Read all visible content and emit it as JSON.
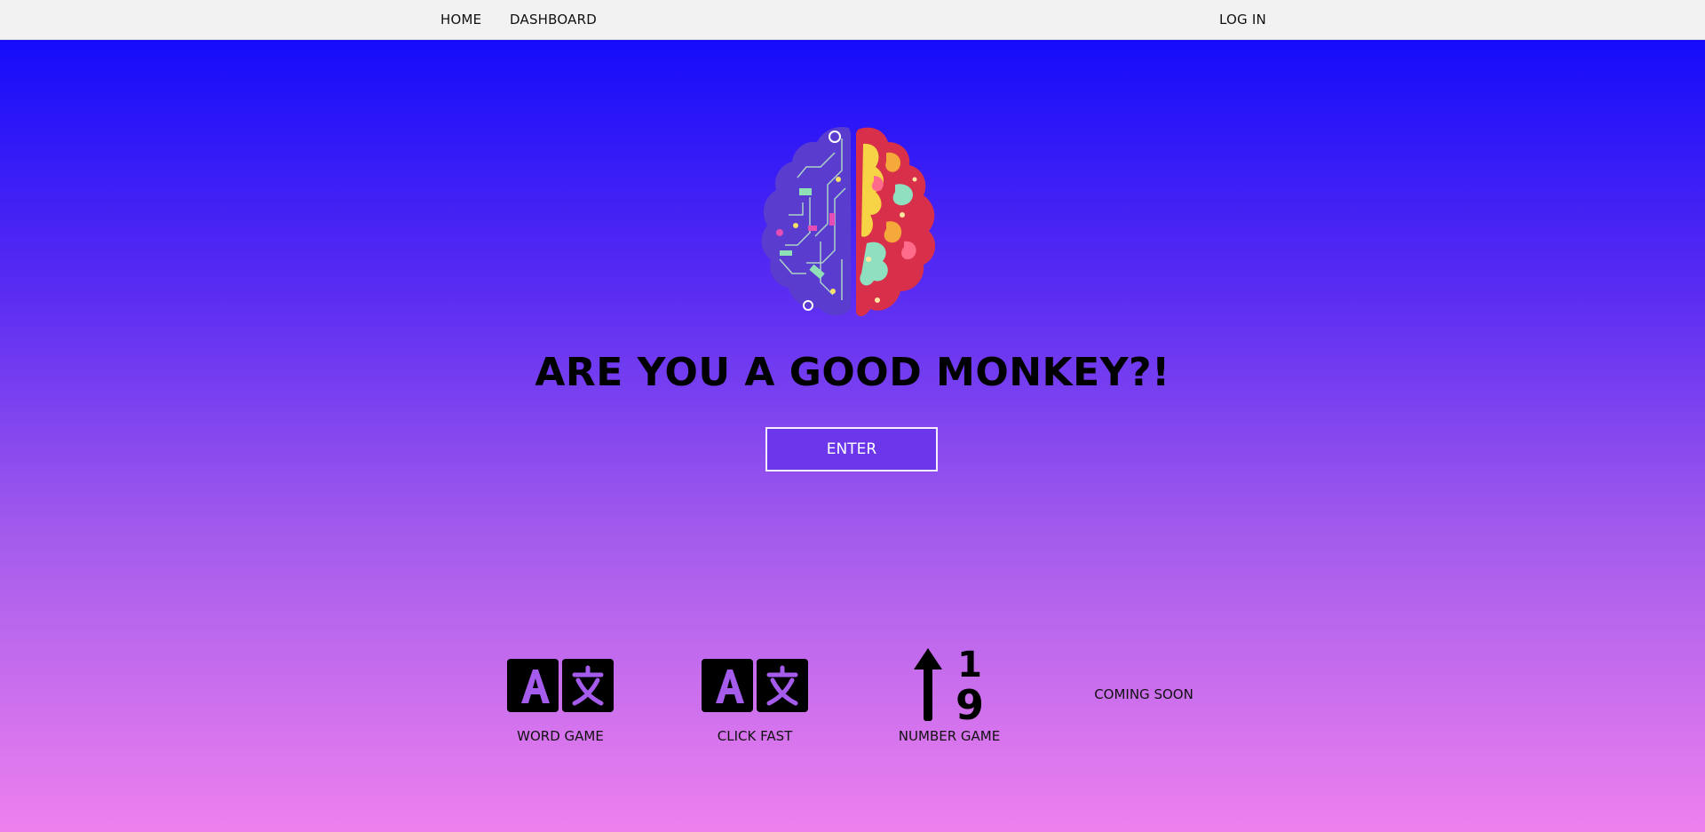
{
  "nav": {
    "home": "HOME",
    "dashboard": "DASHBOARD",
    "login": "LOG IN"
  },
  "hero": {
    "image": "brain-illustration",
    "headline": "ARE YOU A GOOD MONKEY?!",
    "enter_label": "ENTER"
  },
  "games": [
    {
      "label": "WORD GAME",
      "icon": "translate-icon"
    },
    {
      "label": "CLICK FAST",
      "icon": "translate-icon"
    },
    {
      "label": "NUMBER GAME",
      "icon": "sort-numeric-up-icon",
      "digits": [
        "1",
        "9"
      ]
    },
    {
      "label": "COMING SOON",
      "icon": ""
    }
  ],
  "colors": {
    "gradient_top": "#0a07fb",
    "gradient_bottom": "#ee80ee",
    "button_bg": "#6c36ea",
    "navbar_bg": "#f2f2f2"
  }
}
